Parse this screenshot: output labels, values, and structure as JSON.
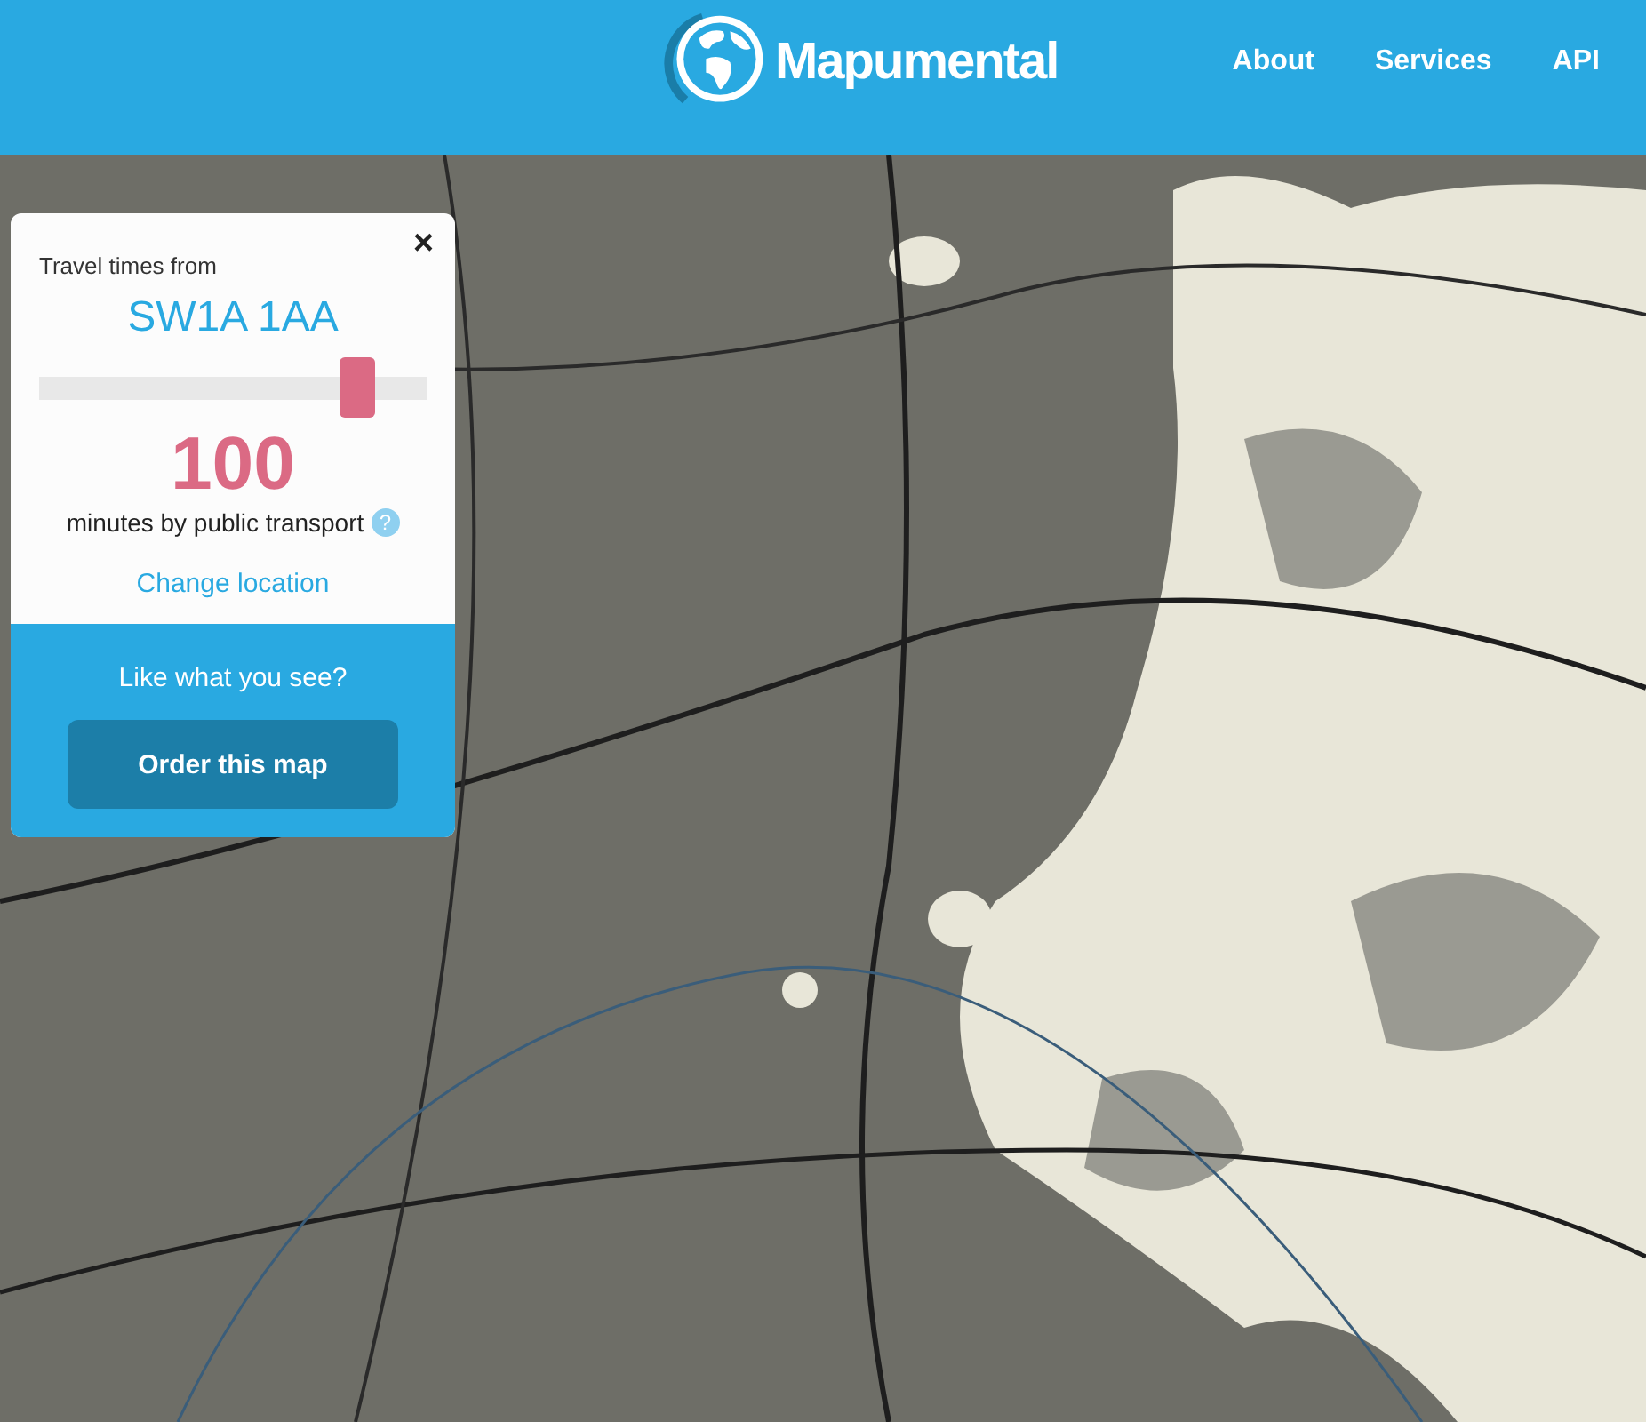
{
  "header": {
    "brand": "Mapumental",
    "nav": [
      {
        "label": "About"
      },
      {
        "label": "Services"
      },
      {
        "label": "API"
      }
    ]
  },
  "panel": {
    "close": "×",
    "heading": "Travel times from",
    "location": "SW1A 1AA",
    "slider": {
      "level": 0.82
    },
    "minutes": "100",
    "mode": "minutes by public transport",
    "help": "?",
    "change_link": "Change location",
    "promo": "Like what you see?",
    "order_button": "Order this map"
  }
}
